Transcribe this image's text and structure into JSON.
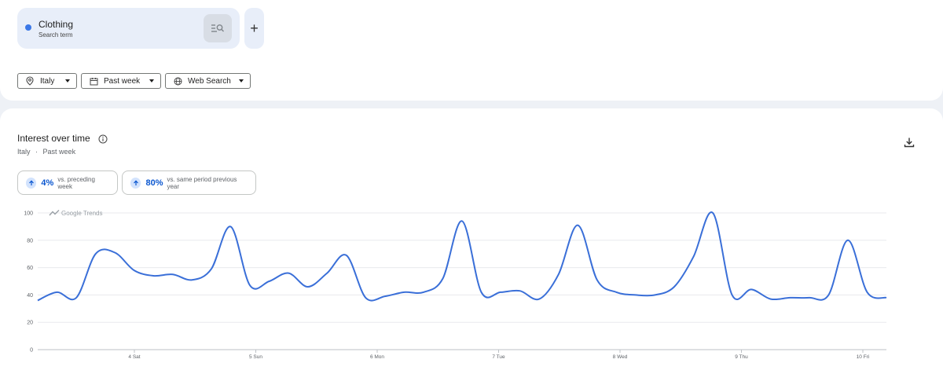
{
  "search": {
    "term": "Clothing",
    "term_type": "Search term",
    "term_color": "#3b78e7",
    "add_label": "+"
  },
  "filters": {
    "region": "Italy",
    "period": "Past week",
    "property": "Web Search"
  },
  "section": {
    "title": "Interest over time",
    "subtitle_region": "Italy",
    "subtitle_sep": "·",
    "subtitle_period": "Past week"
  },
  "stats": [
    {
      "value": "4%",
      "desc": "vs. preceding week",
      "direction": "up"
    },
    {
      "value": "80%",
      "desc": "vs. same period previous year",
      "direction": "up"
    }
  ],
  "watermark": "Google Trends",
  "chart_data": {
    "type": "line",
    "x_ticks": [
      "4 Sat",
      "5 Sun",
      "6 Mon",
      "7 Tue",
      "8 Wed",
      "9 Thu",
      "10 Fri"
    ],
    "y_ticks": [
      0,
      20,
      40,
      60,
      80,
      100
    ],
    "ylim": [
      0,
      100
    ],
    "grid": true,
    "line_color": "#3a6fd8",
    "series": [
      {
        "values": [
          36,
          42,
          38,
          70,
          71,
          58,
          54,
          55,
          51,
          59,
          90,
          47,
          50,
          56,
          46,
          56,
          69,
          38,
          39,
          42,
          42,
          52,
          94,
          42,
          42,
          43,
          37,
          55,
          91,
          51,
          42,
          40,
          40,
          46,
          68,
          100,
          40,
          44,
          37,
          38,
          38,
          40,
          80,
          42,
          38
        ]
      }
    ]
  }
}
